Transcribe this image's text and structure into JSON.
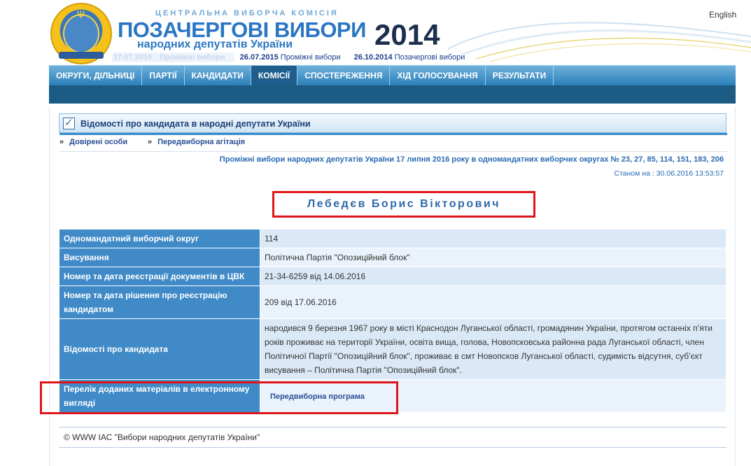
{
  "header": {
    "cvk": "ЦЕНТРАЛЬНА ВИБОРЧА КОМІСІЯ",
    "title": "ПОЗАЧЕРГОВІ ВИБОРИ",
    "subtitle": "народних депутатів України",
    "year": "2014",
    "language_link": "English",
    "elections": [
      {
        "date": "17.07.2016",
        "label": "Проміжні вибори"
      },
      {
        "date": "26.07.2015",
        "label": "Проміжні вибори"
      },
      {
        "date": "26.10.2014",
        "label": "Позачергові вибори"
      }
    ]
  },
  "nav": {
    "items": [
      "ОКРУГИ, ДІЛЬНИЦІ",
      "ПАРТІЇ",
      "КАНДИДАТИ",
      "КОМІСІЇ",
      "СПОСТЕРЕЖЕННЯ",
      "ХІД ГОЛОСУВАННЯ",
      "РЕЗУЛЬТАТИ"
    ],
    "active_index": 3
  },
  "section": {
    "title": "Відомості про кандидата в народні депутати України",
    "links": [
      "Довірені особи",
      "Передвиборна агітація"
    ],
    "election_info": "Проміжні вибори народних депутатів України 17 липня 2016 року в одномандатних виборчих округах № 23, 27, 85, 114, 151, 183, 206",
    "as_of": "Станом на : 30.06.2016 13:53:57"
  },
  "candidate": {
    "name": "Лебедєв Борис Вікторович",
    "rows": [
      {
        "label": "Одномандатний виборчий округ",
        "value": "114"
      },
      {
        "label": "Висування",
        "value": "Політична Партія \"Опозиційний блок\""
      },
      {
        "label": "Номер та дата реєстрації документів в ЦВК",
        "value": "21-34-6259 від 14.06.2016"
      },
      {
        "label": "Номер та дата рішення про реєстрацію кандидатом",
        "value": "209 від 17.06.2016"
      },
      {
        "label": "Відомості про кандидата",
        "value": "народився 9 березня 1967 року в місті Краснодон Луганської області, громадянин України, протягом останніх п’яти років проживає на території України, освіта вища, голова, Новопсковська районна рада Луганської області, член Політичної Партії \"Опозиційний блок\", проживає в смт Новопсков Луганської області, судимість відсутня, суб’єкт висування – Політична Партія \"Опозиційний блок\"."
      },
      {
        "label": "Перелік доданих матеріалів в електронному вигляді",
        "value": "Передвиборна програма"
      }
    ]
  },
  "footer": {
    "text": "© WWW ІАС \"Вибори народних депутатів України\""
  },
  "colors": {
    "nav_blue": "#2b7fb8",
    "label_blue": "#3f8ac7",
    "highlight_red": "#e0141b",
    "title_blue": "#2b76c4"
  }
}
